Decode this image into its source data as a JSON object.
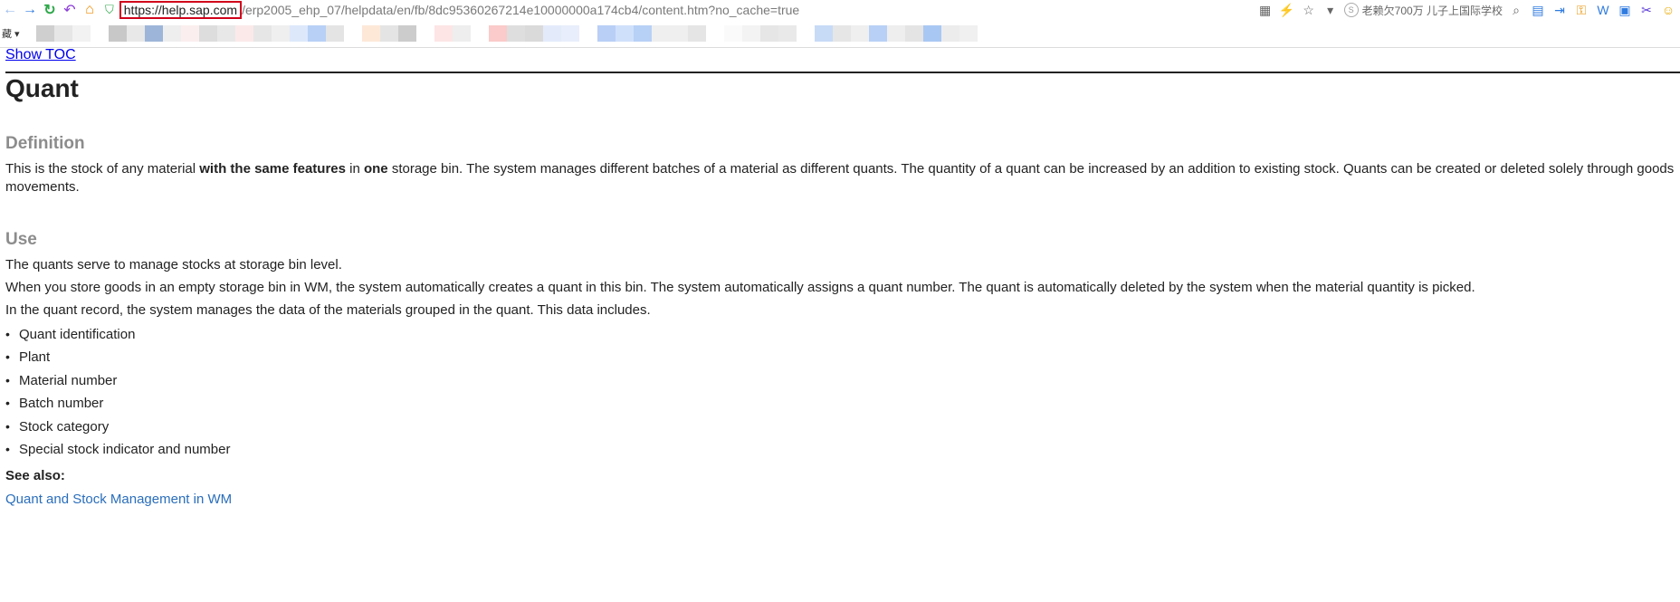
{
  "browser": {
    "url_domain": "https://help.sap.com",
    "url_path": "/erp2005_ehp_07/helpdata/en/fb/8dc95360267214e10000000a174cb4/content.htm?no_cache=true",
    "search_hint": "老赖欠700万 儿子上国际学校",
    "bookmarks_label": "藏 ▾"
  },
  "page": {
    "show_toc": "Show TOC",
    "title": "Quant",
    "definition_heading": "Definition",
    "definition_pre": "This is the stock of any material ",
    "definition_bold1": "with the same features",
    "definition_mid": " in ",
    "definition_bold2": "one",
    "definition_post": " storage bin. The system manages different batches of a material as different quants. The quantity of a quant can be increased by an addition to existing stock. Quants can be created or deleted solely through goods movements.",
    "use_heading": "Use",
    "use_p1": "The quants serve to manage stocks at storage bin level.",
    "use_p2": "When you store goods in an empty storage bin in WM, the system automatically creates a quant in this bin. The system automatically assigns a quant number. The quant is automatically deleted by the system when the material quantity is picked.",
    "use_p3": "In the quant record, the system manages the data of the materials grouped in the quant. This data includes.",
    "data_items": [
      "Quant identification",
      "Plant",
      "Material number",
      "Batch number",
      "Stock category",
      "Special stock indicator and number"
    ],
    "see_also": "See also:",
    "see_also_link": "Quant and Stock Management in WM"
  }
}
